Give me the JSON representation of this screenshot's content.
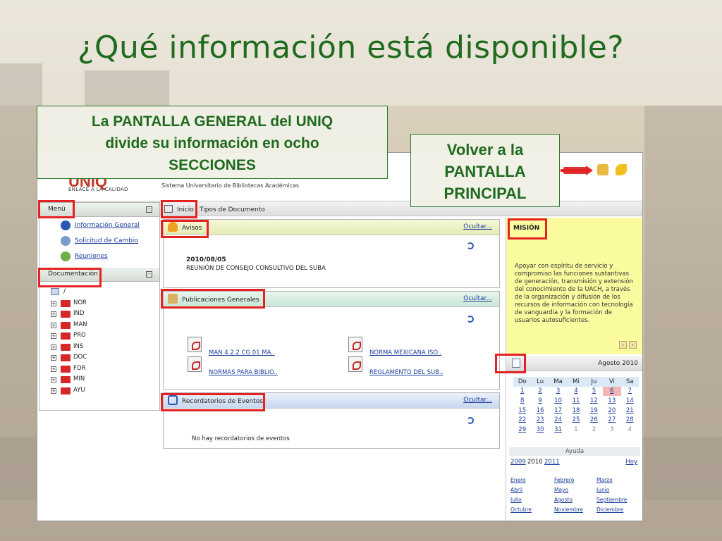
{
  "slide": {
    "title": "¿Qué información está disponible?",
    "callout_main": [
      "La PANTALLA GENERAL del UNIQ",
      "divide su información en ocho",
      "SECCIONES"
    ],
    "callout_back": [
      "Volver a la",
      "PANTALLA",
      "PRINCIPAL"
    ]
  },
  "app": {
    "logo": "UNIQ",
    "logo_sub": "ENLACE A LA CALIDAD",
    "system_name": "Sistema Universitario de Bibliotecas Académicas",
    "tabs": [
      "Inicio",
      "Tipos de Documento"
    ],
    "menu": {
      "title": "Menú",
      "items": [
        "Información General",
        "Solicitud de Cambio",
        "Reuniones"
      ]
    },
    "documentacion": {
      "title": "Documentación",
      "root": "/",
      "folders": [
        "NOR",
        "IND",
        "MAN",
        "PRO",
        "INS",
        "DOC",
        "FOR",
        "MIN",
        "AYU"
      ]
    },
    "avisos": {
      "title": "Avisos",
      "hide_label": "Ocultar...",
      "date": "2010/08/05",
      "text": "REUNIÓN DE CONSEJO CONSULTIVO DEL SUBA"
    },
    "publicaciones": {
      "title": "Publicaciones Generales",
      "hide_label": "Ocultar...",
      "docs": [
        "MAN 4.2.2 CG 01 MA..",
        "NORMA MEXICANA ISO..",
        "NORMAS PARA BIBLIO..",
        "REGLAMENTO DEL SUB.."
      ]
    },
    "eventos": {
      "title": "Recordatorios de Eventos",
      "hide_label": "Ocultar...",
      "empty": "No hay recordatorios de eventos"
    },
    "mision": {
      "title": "MISIÓN",
      "text": "Apoyar con espíritu de servicio y compromiso las funciones sustantivas de generación, transmisión y extensión del conocimiento de la UACH, a través de la organización y difusión de los recursos de información con tecnología de vanguardia y la formación de usuarios autosuficientes."
    },
    "calendar": {
      "month_title": "Agosto 2010",
      "weekdays": [
        "Do",
        "Lu",
        "Ma",
        "Mi",
        "Ju",
        "Vi",
        "Sa"
      ],
      "weeks": [
        [
          "1",
          "2",
          "3",
          "4",
          "5",
          "6",
          "7"
        ],
        [
          "8",
          "9",
          "10",
          "11",
          "12",
          "13",
          "14"
        ],
        [
          "15",
          "16",
          "17",
          "18",
          "19",
          "20",
          "21"
        ],
        [
          "22",
          "23",
          "24",
          "25",
          "26",
          "27",
          "28"
        ],
        [
          "29",
          "30",
          "31",
          "1",
          "2",
          "3",
          "4"
        ]
      ],
      "today": "6",
      "help": "Ayuda",
      "prev_year": "2009",
      "year": "2010",
      "next_year": "2011",
      "today_label": "Hoy",
      "months": [
        "Enero",
        "Febrero",
        "Marzo",
        "Abril",
        "Mayo",
        "Junio",
        "Julio",
        "Agosto",
        "Septiembre",
        "Octubre",
        "Noviembre",
        "Diciembre"
      ]
    }
  }
}
